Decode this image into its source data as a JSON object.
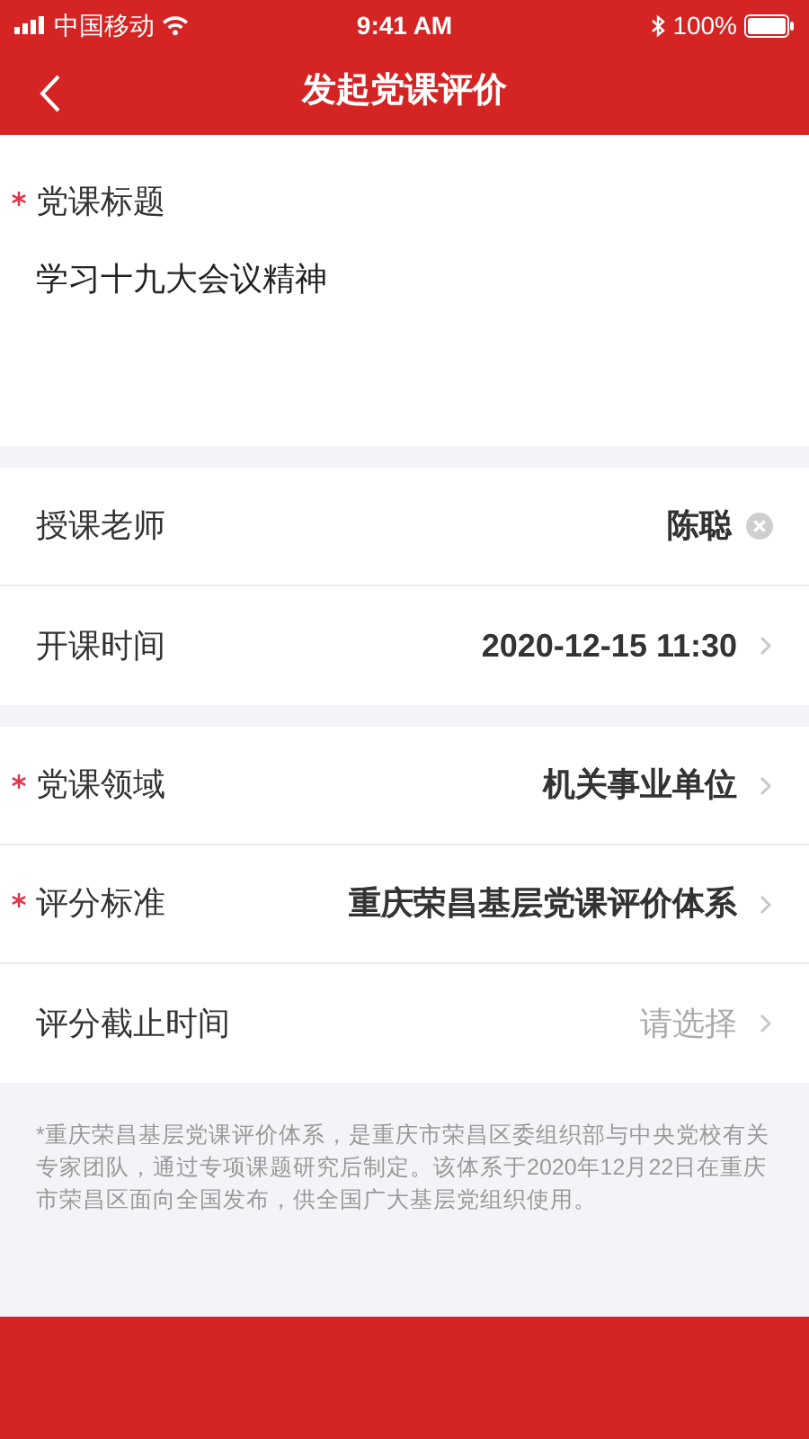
{
  "status_bar": {
    "carrier": "中国移动",
    "time": "9:41 AM",
    "battery": "100%"
  },
  "nav": {
    "title": "发起党课评价"
  },
  "title_field": {
    "label": "党课标题",
    "required": true,
    "value": "学习十九大会议精神"
  },
  "groups": [
    [
      {
        "label": "授课老师",
        "required": false,
        "kind": "clear",
        "value": "陈聪"
      },
      {
        "label": "开课时间",
        "required": false,
        "kind": "select",
        "value": "2020-12-15 11:30"
      }
    ],
    [
      {
        "label": "党课领域",
        "required": true,
        "kind": "select",
        "value": "机关事业单位"
      },
      {
        "label": "评分标准",
        "required": true,
        "kind": "select",
        "value": "重庆荣昌基层党课评价体系"
      },
      {
        "label": "评分截止时间",
        "required": false,
        "kind": "select",
        "placeholder": "请选择"
      }
    ]
  ],
  "note": "*重庆荣昌基层党课评价体系，是重庆市荣昌区委组织部与中央党校有关专家团队，通过专项课题研究后制定。该体系于2020年12月22日在重庆市荣昌区面向全国发布，供全国广大基层党组织使用。"
}
